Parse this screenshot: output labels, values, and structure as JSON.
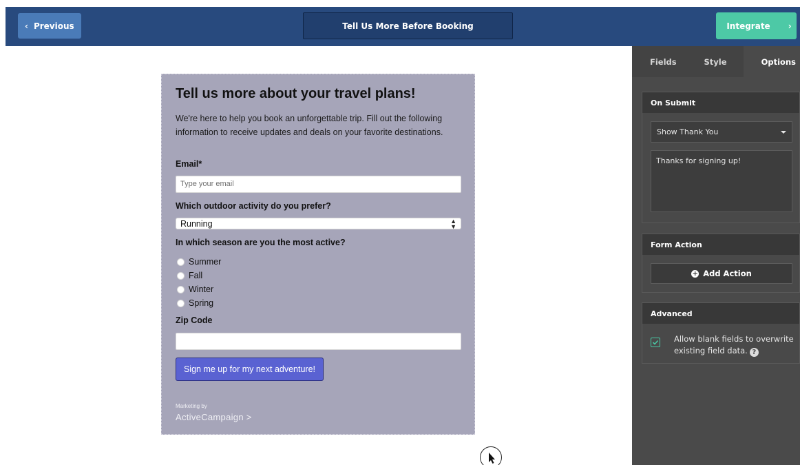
{
  "topbar": {
    "previous_label": "Previous",
    "previous_chevron": "‹",
    "title": "Tell Us More Before Booking",
    "integrate_label": "Integrate",
    "integrate_chevron": "›"
  },
  "form": {
    "heading": "Tell us more about your travel plans!",
    "intro": "We're here to help you book an unforgettable trip. Fill out the following information to receive updates and deals on your favorite destinations.",
    "email_label": "Email*",
    "email_placeholder": "Type your email",
    "activity_label": "Which outdoor activity do you prefer?",
    "activity_value": "Running",
    "season_label": "In which season are you the most active?",
    "season_options": [
      "Summer",
      "Fall",
      "Winter",
      "Spring"
    ],
    "zip_label": "Zip Code",
    "submit_label": "Sign me up for my next adventure!",
    "marketing_by": "Marketing by",
    "brand": "ActiveCampaign >"
  },
  "panel": {
    "tabs": [
      "Fields",
      "Style",
      "Options"
    ],
    "active_tab": "Options",
    "on_submit": {
      "title": "On Submit",
      "dropdown_value": "Show Thank You",
      "message": "Thanks for signing up!"
    },
    "form_action": {
      "title": "Form Action",
      "add_action_label": "Add Action"
    },
    "advanced": {
      "title": "Advanced",
      "checkbox_checked": true,
      "checkbox_label": "Allow blank fields to overwrite existing field data."
    }
  },
  "colors": {
    "topbar": "#284a7e",
    "previous_button": "#4a7bb8",
    "integrate_button": "#4dc9a6",
    "form_background": "#a6a5b9",
    "submit_button": "#5a62d2",
    "panel_background": "#4a4a4a"
  },
  "icons": [
    "chevron-left-icon",
    "chevron-right-icon",
    "select-arrows-icon",
    "caret-down-icon",
    "plus-circle-icon",
    "checkmark-icon",
    "help-icon",
    "cursor-icon"
  ]
}
